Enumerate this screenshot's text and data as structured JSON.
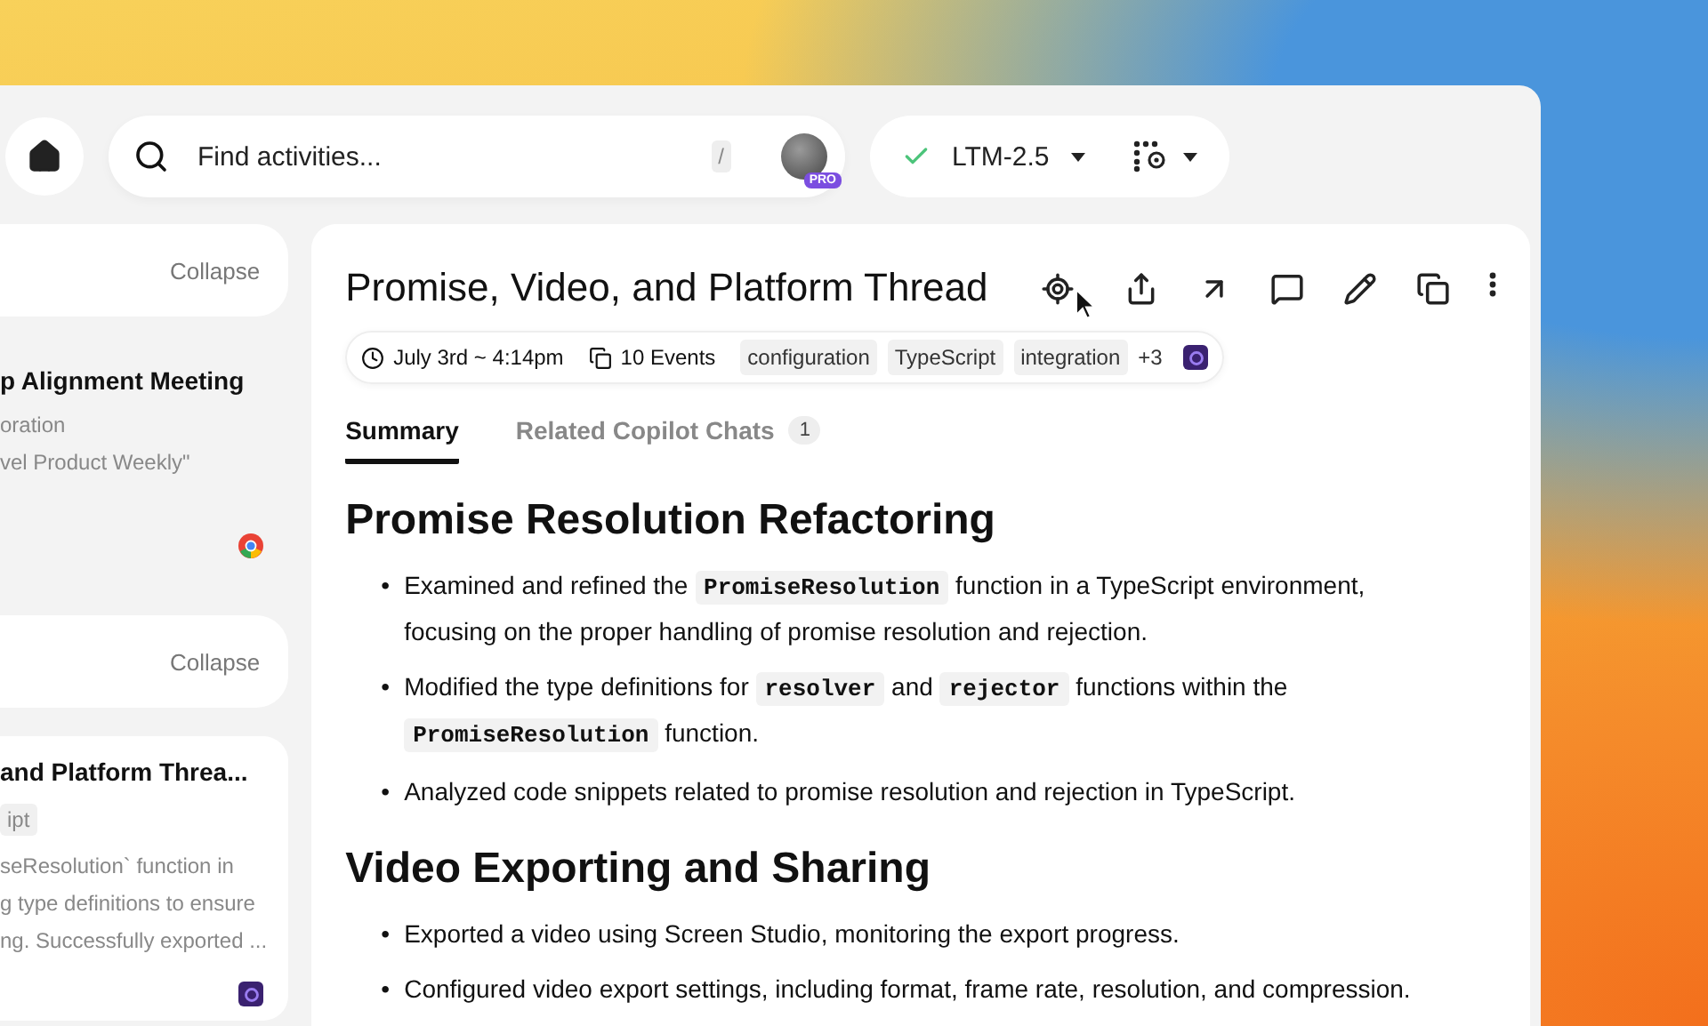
{
  "search": {
    "placeholder": "Find activities...",
    "shortcut": "/",
    "badge": "PRO"
  },
  "model": {
    "label": "LTM-2.5",
    "ready": true
  },
  "sidebar": {
    "groups": [
      {
        "collapse": "Collapse",
        "items": [
          {
            "title": "p Alignment Meeting",
            "lines": [
              "oration",
              "vel Product Weekly\""
            ],
            "kind": "browser",
            "selected": false
          }
        ]
      },
      {
        "collapse": "Collapse",
        "items": [
          {
            "title": "and Platform Threa...",
            "tag": "ipt",
            "lines": [
              "seResolution` function in",
              "g type definitions to ensure",
              "ng. Successfully exported ..."
            ],
            "kind": "copilot",
            "selected": true
          }
        ]
      }
    ]
  },
  "detail": {
    "title": "Promise, Video, and Platform Thread",
    "meta": {
      "time": "July 3rd ~ 4:14pm",
      "events": "10 Events",
      "tags": [
        "configuration",
        "TypeScript",
        "integration"
      ],
      "more": "+3"
    },
    "tabs": [
      {
        "label": "Summary",
        "selected": true
      },
      {
        "label": "Related Copilot Chats",
        "count": "1",
        "selected": false
      }
    ],
    "sections": [
      {
        "heading": "Promise Resolution Refactoring",
        "bullets": [
          {
            "marker": "•",
            "parts": [
              {
                "text": "Examined and refined the ",
                "code": false
              },
              {
                "text": "PromiseResolution",
                "code": true
              },
              {
                "text": " function in a TypeScript environment, focusing on the proper handling of promise resolution and rejection.",
                "code": false
              }
            ]
          },
          {
            "marker": "•",
            "parts": [
              {
                "text": "Modified the type definitions for ",
                "code": false
              },
              {
                "text": "resolver",
                "code": true
              },
              {
                "text": " and ",
                "code": false
              },
              {
                "text": "rejector",
                "code": true
              },
              {
                "text": " functions within the ",
                "code": false
              },
              {
                "text": "PromiseResolution",
                "code": true
              },
              {
                "text": " function.",
                "code": false
              }
            ]
          },
          {
            "marker": "•",
            "parts": [
              {
                "text": "Analyzed code snippets related to promise resolution and rejection in TypeScript.",
                "code": false
              }
            ]
          }
        ]
      },
      {
        "heading": "Video Exporting and Sharing",
        "bullets": [
          {
            "marker": "•",
            "parts": [
              {
                "text": "Exported a video using Screen Studio, monitoring the export progress.",
                "code": false
              }
            ]
          },
          {
            "marker": "•",
            "parts": [
              {
                "text": "Configured video export settings, including format, frame rate, resolution, and compression.",
                "code": false
              }
            ]
          }
        ]
      }
    ]
  }
}
